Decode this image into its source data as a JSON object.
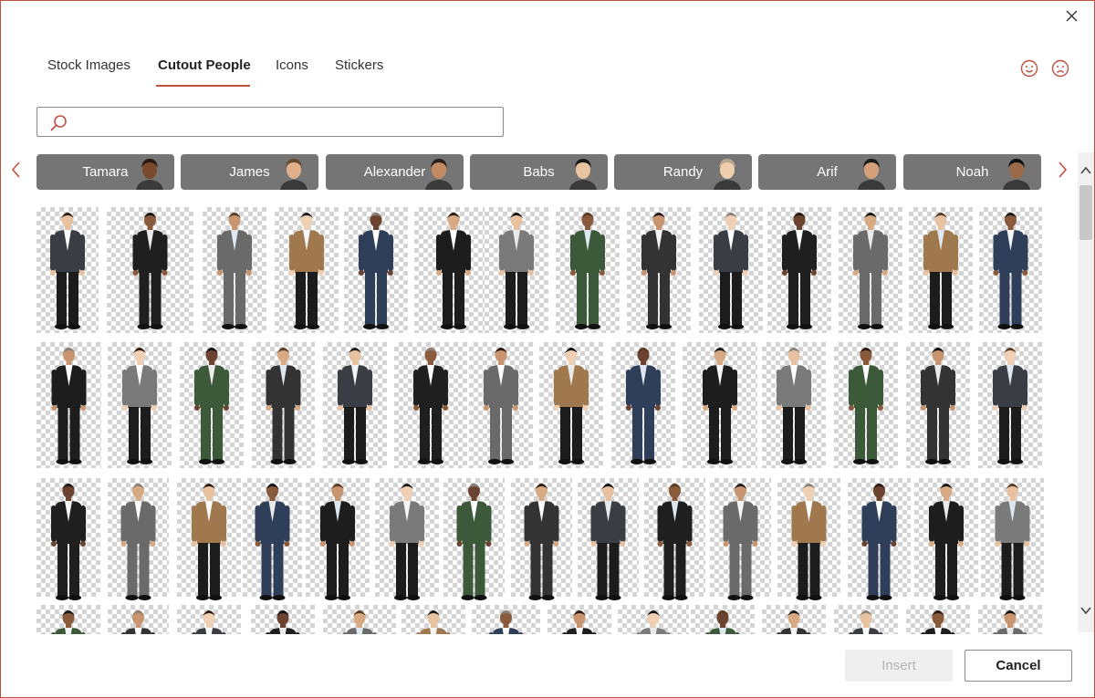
{
  "tabs": [
    {
      "label": "Stock Images",
      "active": false
    },
    {
      "label": "Cutout People",
      "active": true
    },
    {
      "label": "Icons",
      "active": false
    },
    {
      "label": "Stickers",
      "active": false
    }
  ],
  "search": {
    "value": "",
    "placeholder": ""
  },
  "people_chips": [
    {
      "name": "Tamara"
    },
    {
      "name": "James"
    },
    {
      "name": "Alexander"
    },
    {
      "name": "Babs"
    },
    {
      "name": "Randy"
    },
    {
      "name": "Arif"
    },
    {
      "name": "Noah"
    }
  ],
  "buttons": {
    "insert": "Insert",
    "cancel": "Cancel"
  },
  "colors": {
    "accent": "#c0503f",
    "chip_bg": "#757575",
    "disabled_bg": "#efefef"
  },
  "icons": {
    "close": "close-icon",
    "smile": "smile-icon",
    "frown": "frown-icon",
    "search": "search-icon",
    "prev": "chevron-left-icon",
    "next": "chevron-right-icon"
  }
}
